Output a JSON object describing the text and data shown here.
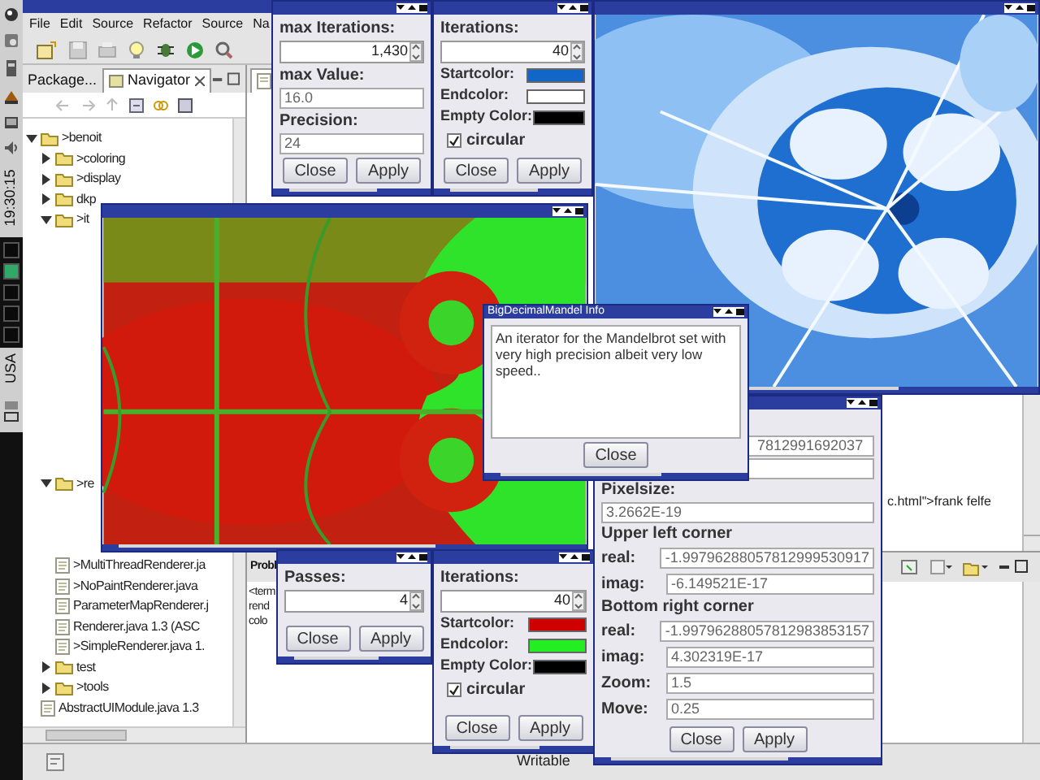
{
  "taskbar": {
    "clock": "19:30:15",
    "keyboard_layout": "USA"
  },
  "ide": {
    "menu": [
      "File",
      "Edit",
      "Source",
      "Refactor",
      "Source",
      "Na"
    ],
    "views": [
      {
        "label": "Package...",
        "selected": false
      },
      {
        "label": "Navigator",
        "selected": true
      }
    ],
    "tree": [
      {
        "label": ">benoit",
        "kind": "folder",
        "expanded": true,
        "children": [
          {
            "label": ">coloring",
            "kind": "folder",
            "expanded": false
          },
          {
            "label": ">display",
            "kind": "folder",
            "expanded": false
          },
          {
            "label": "dkp",
            "kind": "folder",
            "expanded": false
          },
          {
            "label": ">it",
            "kind": "folder",
            "expanded": true
          },
          {
            "label": ">re",
            "kind": "folder",
            "expanded": true,
            "children": [
              {
                "label": ">MultiThreadRenderer.ja",
                "kind": "file"
              },
              {
                "label": ">NoPaintRenderer.java",
                "kind": "file"
              },
              {
                "label": "ParameterMapRenderer.j",
                "kind": "file"
              },
              {
                "label": "Renderer.java  1.3  (ASC",
                "kind": "file"
              },
              {
                "label": ">SimpleRenderer.java  1.",
                "kind": "file"
              }
            ]
          },
          {
            "label": "test",
            "kind": "folder",
            "expanded": false
          },
          {
            "label": ">tools",
            "kind": "folder",
            "expanded": false
          },
          {
            "label": "AbstractUIModule.java  1.3",
            "kind": "file"
          }
        ]
      }
    ],
    "problems_tab": "Probl",
    "problems_lines": [
      "<term",
      "rend",
      "colo"
    ],
    "editor_line": "c.html\">frank felfe",
    "status": "Writable"
  },
  "dialogs": [
    {
      "rows": [
        {
          "kind": "label",
          "text": "max Iterations:"
        },
        {
          "kind": "spinner",
          "value": "1,430"
        },
        {
          "kind": "label",
          "text": "max Value:"
        },
        {
          "kind": "text",
          "value": "16.0"
        },
        {
          "kind": "label",
          "text": "Precision:"
        },
        {
          "kind": "text",
          "value": "24"
        }
      ],
      "buttons": [
        "Close",
        "Apply"
      ]
    },
    {
      "rows": [
        {
          "kind": "label",
          "text": "Iterations:"
        },
        {
          "kind": "spinner",
          "value": "40"
        },
        {
          "kind": "color",
          "label": "Startcolor:",
          "color": "#1266c8"
        },
        {
          "kind": "color",
          "label": "Endcolor:",
          "color": "#ffffff"
        },
        {
          "kind": "color",
          "label": "Empty Color:",
          "color": "#000000"
        },
        {
          "kind": "checkbox",
          "label": "circular",
          "checked": true
        }
      ],
      "buttons": [
        "Close",
        "Apply"
      ]
    },
    {
      "rows": [
        {
          "kind": "label",
          "text": "Passes:"
        },
        {
          "kind": "spinner",
          "value": "4"
        }
      ],
      "buttons": [
        "Close",
        "Apply"
      ]
    },
    {
      "rows": [
        {
          "kind": "label",
          "text": "Iterations:"
        },
        {
          "kind": "spinner",
          "value": "40"
        },
        {
          "kind": "color",
          "label": "Startcolor:",
          "color": "#d00000"
        },
        {
          "kind": "color",
          "label": "Endcolor:",
          "color": "#22ee22"
        },
        {
          "kind": "color",
          "label": "Empty Color:",
          "color": "#000000"
        },
        {
          "kind": "checkbox",
          "label": "circular",
          "checked": true
        }
      ],
      "buttons": [
        "Close",
        "Apply"
      ]
    },
    {
      "rows": [
        {
          "kind": "covered",
          "value": "7812991692037"
        },
        {
          "kind": "text"
        },
        {
          "kind": "label",
          "text": "Pixelsize:"
        },
        {
          "kind": "text",
          "value": "3.2662E-19"
        },
        {
          "kind": "label",
          "text": "Upper left corner"
        },
        {
          "kind": "pair",
          "label": "real:",
          "value": "-1.99796288057812999530917"
        },
        {
          "kind": "pair",
          "label": "imag:",
          "value": "-6.149521E-17"
        },
        {
          "kind": "label",
          "text": "Bottom right corner"
        },
        {
          "kind": "pair",
          "label": "real:",
          "value": "-1.99796288057812983853157"
        },
        {
          "kind": "pair",
          "label": "imag:",
          "value": "4.302319E-17"
        },
        {
          "kind": "pair",
          "label": "Zoom:",
          "value": "1.5"
        },
        {
          "kind": "pair",
          "label": "Move:",
          "value": "0.25"
        }
      ],
      "buttons": [
        "Close",
        "Apply"
      ]
    },
    {
      "title": "BigDecimalMandel Info",
      "rows": [
        {
          "kind": "message",
          "text": "An iterator for the Mandelbrot set with very high precision albeit very low speed.."
        }
      ],
      "buttons": [
        "Close"
      ]
    }
  ]
}
